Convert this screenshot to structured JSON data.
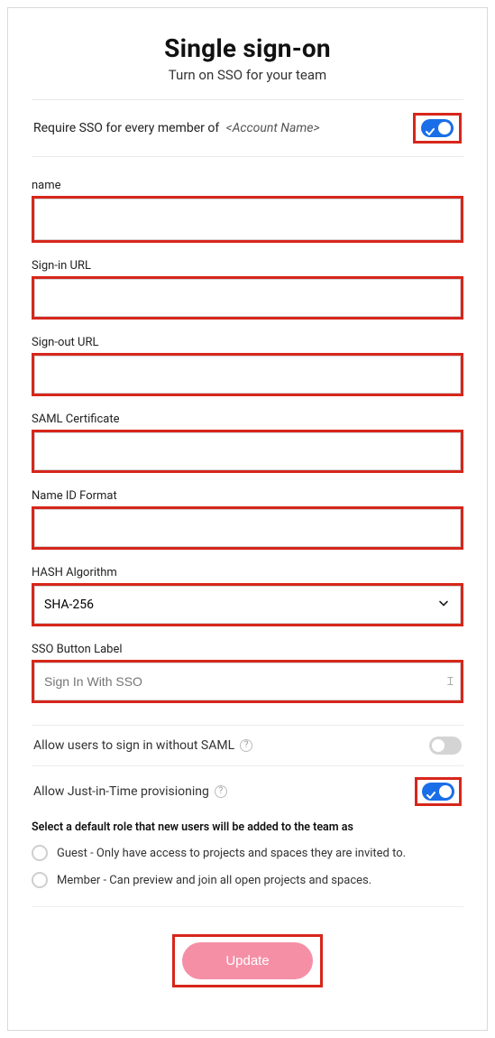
{
  "header": {
    "title": "Single sign-on",
    "subtitle": "Turn on SSO for your team"
  },
  "require_sso": {
    "label_prefix": "Require SSO for every member of",
    "account_placeholder": "<Account Name>",
    "enabled": true
  },
  "fields": {
    "name": {
      "label": "name",
      "value": ""
    },
    "signin_url": {
      "label": "Sign-in URL",
      "value": ""
    },
    "signout_url": {
      "label": "Sign-out URL",
      "value": ""
    },
    "saml_cert": {
      "label": "SAML Certificate",
      "value": ""
    },
    "name_id": {
      "label": "Name ID Format",
      "value": ""
    },
    "hash_algo": {
      "label": "HASH Algorithm",
      "value": "SHA-256"
    },
    "sso_button": {
      "label": "SSO Button Label",
      "placeholder": "Sign In With SSO"
    }
  },
  "allow_without_saml": {
    "label": "Allow users to sign in without SAML",
    "enabled": false
  },
  "jit": {
    "label": "Allow Just-in-Time provisioning",
    "enabled": true,
    "desc": "Select a default role that new users will be added to the team as",
    "options": [
      "Guest - Only have access to projects and spaces they are invited to.",
      "Member - Can preview and join all open projects and spaces."
    ]
  },
  "actions": {
    "update": "Update"
  },
  "colors": {
    "highlight": "#d7261b",
    "toggle_on": "#1a6ee8",
    "button_bg": "#f58fa6"
  }
}
